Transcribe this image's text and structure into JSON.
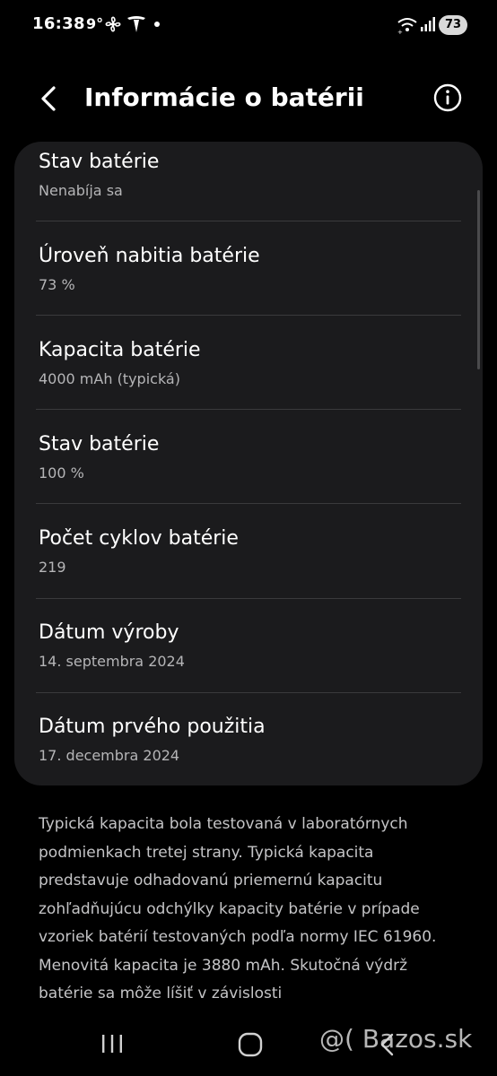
{
  "status_bar": {
    "time": "16:38",
    "temperature": "9°",
    "battery_level": "73",
    "icons": [
      "fan-icon",
      "tesla-icon",
      "notification-dot-icon",
      "wifi-icon",
      "signal-icon",
      "battery-icon"
    ]
  },
  "header": {
    "title": "Informácie o batérii",
    "back_icon": "chevron-left-icon",
    "info_icon": "info-circle-icon"
  },
  "items": [
    {
      "title": "Stav batérie",
      "value": "Nenabíja sa"
    },
    {
      "title": "Úroveň nabitia batérie",
      "value": "73 %"
    },
    {
      "title": "Kapacita batérie",
      "value": "4000 mAh (typická)"
    },
    {
      "title": "Stav batérie",
      "value": "100 %"
    },
    {
      "title": "Počet cyklov batérie",
      "value": "219"
    },
    {
      "title": "Dátum výroby",
      "value": "14. septembra 2024"
    },
    {
      "title": "Dátum prvého použitia",
      "value": "17. decembra 2024"
    }
  ],
  "note": "Typická kapacita bola testovaná v laboratórnych podmienkach tretej strany. Typická kapacita predstavuje odhadovanú priemernú kapacitu zohľadňujúcu odchýlky kapacity batérie v prípade vzoriek batérií testovaných podľa normy IEC 61960. Menovitá kapacita je 3880 mAh. Skutočná výdrž batérie sa môže líšiť v závislosti",
  "nav": {
    "icons": [
      "recent-apps-icon",
      "home-icon",
      "back-icon"
    ]
  },
  "watermark": "@( Bazos.sk",
  "colors": {
    "background": "#000000",
    "card": "#1b1b1d",
    "divider": "#3a3a3c",
    "secondary_text": "#b5b5b7"
  }
}
